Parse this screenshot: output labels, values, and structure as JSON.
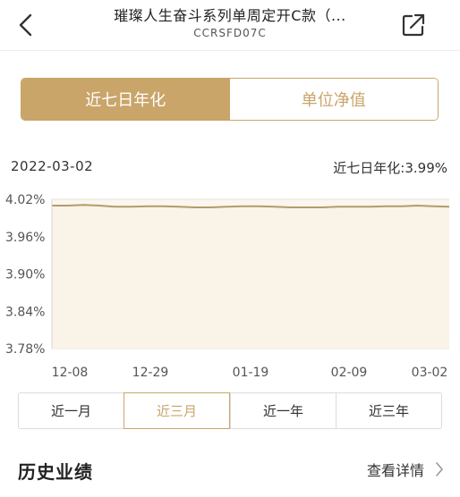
{
  "header": {
    "title": "璀璨人生奋斗系列单周定开C款（...",
    "code": "CCRSFD07C",
    "back_icon": "chevron-left-icon",
    "share_icon": "share-external-icon"
  },
  "tabs": [
    {
      "label": "近七日年化",
      "active": true
    },
    {
      "label": "单位净值",
      "active": false
    }
  ],
  "info": {
    "date": "2022-03-02",
    "value_text": "近七日年化:3.99%"
  },
  "chart_data": {
    "type": "area",
    "y_ticks": [
      "4.02%",
      "3.96%",
      "3.90%",
      "3.84%",
      "3.78%"
    ],
    "x_ticks": [
      "12-08",
      "12-29",
      "01-19",
      "02-09",
      "03-02"
    ],
    "ylim": [
      3.78,
      4.02
    ],
    "values": [
      4.01,
      4.01,
      4.011,
      4.01,
      4.008,
      4.008,
      4.009,
      4.009,
      4.008,
      4.007,
      4.007,
      4.008,
      4.009,
      4.009,
      4.008,
      4.007,
      4.007,
      4.007,
      4.008,
      4.008,
      4.008,
      4.009,
      4.009,
      4.01,
      4.009,
      4.008
    ],
    "line_color": "#b49c6a",
    "fill_color": "#fbf6ef"
  },
  "ranges": [
    {
      "label": "近一月",
      "active": false
    },
    {
      "label": "近三月",
      "active": true
    },
    {
      "label": "近一年",
      "active": false
    },
    {
      "label": "近三年",
      "active": false
    }
  ],
  "history": {
    "title": "历史业绩",
    "link": "查看详情"
  },
  "colors": {
    "accent": "#c9a56a"
  }
}
